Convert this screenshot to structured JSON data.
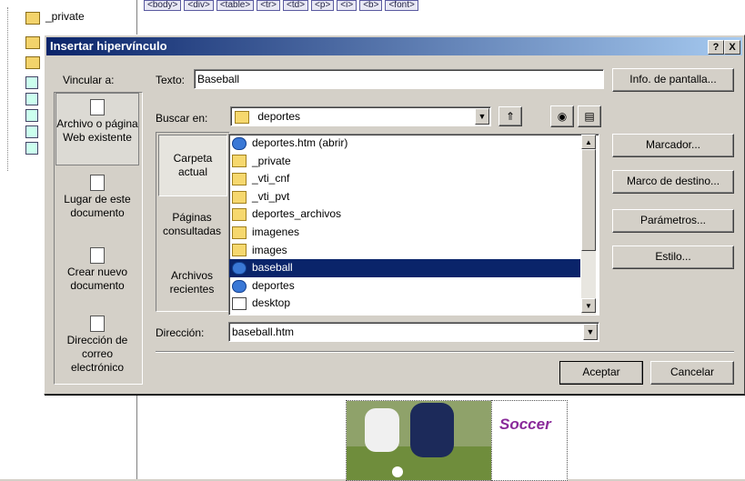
{
  "background": {
    "tree_folders": [
      "_private"
    ],
    "tags": [
      "<body>",
      "<div>",
      "<table>",
      "<tr>",
      "<td>",
      "<p>",
      "<i>",
      "<b>",
      "<font>"
    ],
    "soccer_label": "Soccer"
  },
  "dialog": {
    "title": "Insertar hipervínculo",
    "help_btn": "?",
    "close_btn": "X",
    "vincular_label": "Vincular a:",
    "texto_label": "Texto:",
    "texto_value": "Baseball",
    "info_btn": "Info. de pantalla...",
    "buscar_label": "Buscar en:",
    "buscar_value": "deportes",
    "link_types": [
      {
        "label": "Archivo o página Web existente"
      },
      {
        "label": "Lugar de este documento"
      },
      {
        "label": "Crear nuevo documento"
      },
      {
        "label": "Dirección de correo electrónico"
      }
    ],
    "places": [
      {
        "label": "Carpeta actual"
      },
      {
        "label": "Páginas consultadas"
      },
      {
        "label": "Archivos recientes"
      }
    ],
    "files": [
      {
        "name": "deportes.htm (abrir)",
        "icon": "ie"
      },
      {
        "name": "_private",
        "icon": "folder"
      },
      {
        "name": "_vti_cnf",
        "icon": "folder"
      },
      {
        "name": "_vti_pvt",
        "icon": "folder"
      },
      {
        "name": "deportes_archivos",
        "icon": "folder"
      },
      {
        "name": "imagenes",
        "icon": "folder"
      },
      {
        "name": "images",
        "icon": "folder"
      },
      {
        "name": "baseball",
        "icon": "ie"
      },
      {
        "name": "deportes",
        "icon": "ie"
      },
      {
        "name": "desktop",
        "icon": "doc"
      }
    ],
    "selected_file": "baseball",
    "right_buttons": [
      "Marcador...",
      "Marco de destino...",
      "Parámetros...",
      "Estilo..."
    ],
    "direccion_label": "Dirección:",
    "direccion_value": "baseball.htm",
    "ok_btn": "Aceptar",
    "cancel_btn": "Cancelar"
  }
}
